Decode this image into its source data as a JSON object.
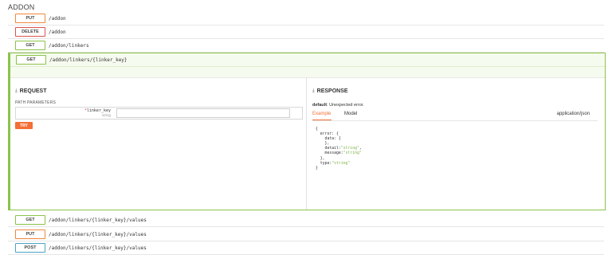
{
  "section": {
    "title": "ADDON"
  },
  "endpoints_top": [
    {
      "method": "PUT",
      "path": "/addon"
    },
    {
      "method": "DELETE",
      "path": "/addon"
    },
    {
      "method": "GET",
      "path": "/addon/linkers"
    }
  ],
  "expanded": {
    "method": "GET",
    "path": "/addon/linkers/{linker_key}",
    "request": {
      "title": "REQUEST",
      "params_label": "PATH PARAMETERS",
      "param_required": "*",
      "param_name": "linker_key",
      "param_type": "string",
      "param_value": "",
      "try_label": "TRY"
    },
    "response": {
      "title": "RESPONSE",
      "default_label": "default",
      "description": ": Unexpected error.",
      "tab_example": "Example",
      "tab_model": "Model",
      "content_type": "application/json",
      "code": {
        "l1": "{",
        "l2": "  error: {",
        "l3": "    data: {",
        "l4": "    },",
        "l5_key": "    detail:",
        "l5_val": "\"string\"",
        "l5_end": ",",
        "l6_key": "    message:",
        "l6_val": "\"string\"",
        "l7": "  },",
        "l8_key": "  type:",
        "l8_val": "\"string\"",
        "l9": "}"
      }
    }
  },
  "endpoints_bottom": [
    {
      "method": "GET",
      "path": "/addon/linkers/{linker_key}/values"
    },
    {
      "method": "PUT",
      "path": "/addon/linkers/{linker_key}/values"
    },
    {
      "method": "POST",
      "path": "/addon/linkers/{linker_key}/values"
    }
  ],
  "colors": {
    "get": "#8bc34a",
    "put": "#f0883e",
    "delete": "#d9534f",
    "post": "#4aa3c8",
    "accent": "#f36f36"
  },
  "icons": {
    "request": "upload-arrow-icon",
    "response": "download-arrow-icon"
  }
}
